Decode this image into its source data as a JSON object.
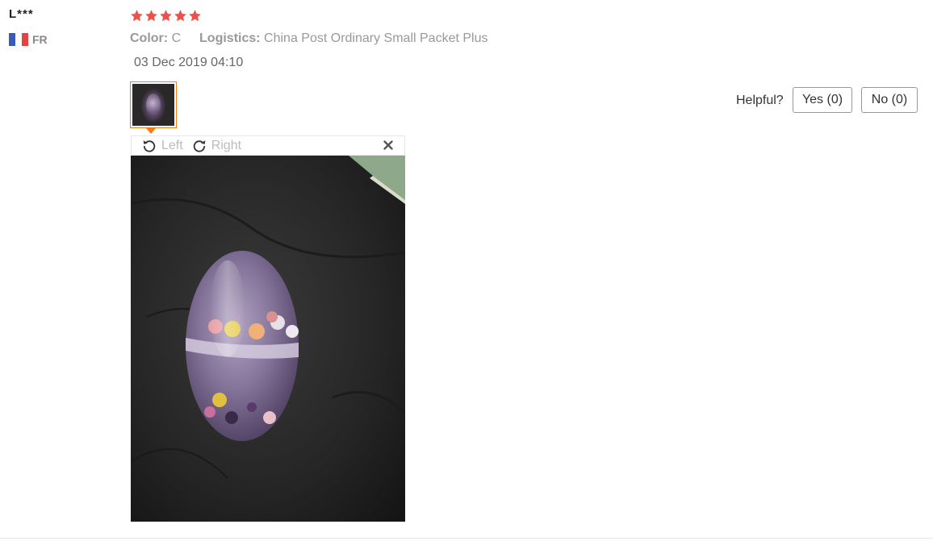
{
  "review": {
    "user_name": "L***",
    "country_code": "FR",
    "flag_colors": [
      "#3a5ab8",
      "#ffffff",
      "#e8403c"
    ],
    "rating": 5,
    "rating_max": 5,
    "star_color": "#f0504a",
    "color_label": "Color:",
    "color_value": "C",
    "logistics_label": "Logistics:",
    "logistics_value": "China Post Ordinary Small Packet Plus",
    "date": "03 Dec 2019 04:10"
  },
  "viewer": {
    "rotate_left_label": "Left",
    "rotate_right_label": "Right",
    "rotate_left_icon": "rotate-left-icon",
    "rotate_right_icon": "rotate-right-icon",
    "close_icon": "close-icon",
    "accent_color": "#f07c1a"
  },
  "helpful": {
    "prompt": "Helpful?",
    "yes_label": "Yes (0)",
    "no_label": "No (0)"
  }
}
